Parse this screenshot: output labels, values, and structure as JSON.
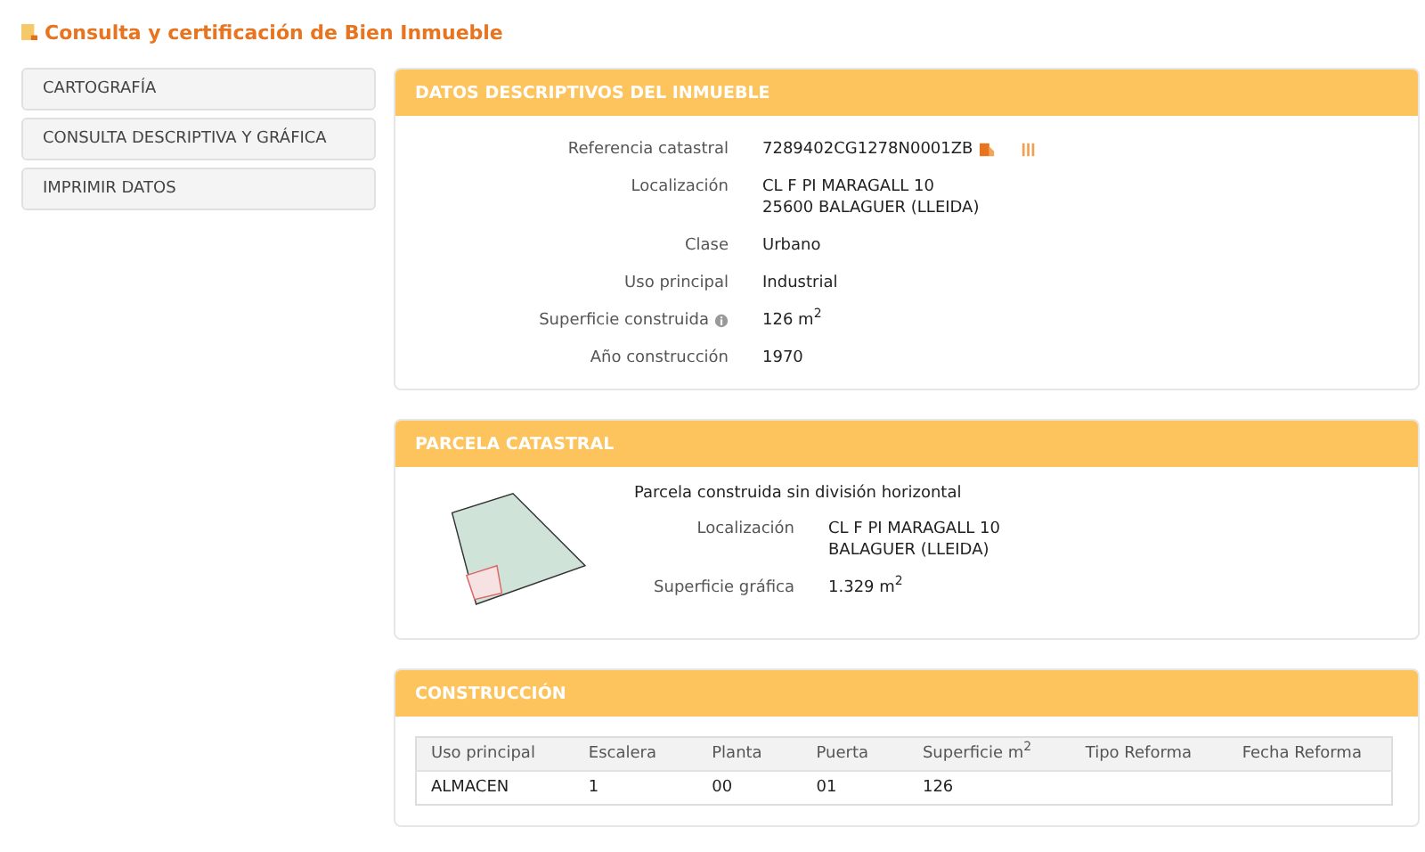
{
  "page_title": "Consulta y certificación de Bien Inmueble",
  "sidebar": {
    "items": [
      {
        "label": "CARTOGRAFÍA"
      },
      {
        "label": "CONSULTA DESCRIPTIVA Y GRÁFICA"
      },
      {
        "label": "IMPRIMIR DATOS"
      }
    ]
  },
  "datos": {
    "title": "DATOS DESCRIPTIVOS DEL INMUEBLE",
    "fields": [
      {
        "label": "Referencia catastral",
        "lines": [
          "7289402CG1278N0001ZB"
        ],
        "kind": "reference"
      },
      {
        "label": "Localización",
        "lines": [
          "CL F PI MARAGALL 10",
          "25600 BALAGUER (LLEIDA)"
        ],
        "kind": "plain"
      },
      {
        "label": "Clase",
        "lines": [
          "Urbano"
        ],
        "kind": "plain"
      },
      {
        "label": "Uso principal",
        "lines": [
          "Industrial"
        ],
        "kind": "plain"
      },
      {
        "label": "Superficie construida",
        "lines": [
          "126 m$^{2}$"
        ],
        "kind": "info"
      },
      {
        "label": "Año construcción",
        "lines": [
          "1970"
        ],
        "kind": "plain"
      }
    ]
  },
  "parcela": {
    "title": "PARCELA CATASTRAL",
    "subtitle": "Parcela construida sin división horizontal",
    "fields": [
      {
        "label": "Localización",
        "lines": [
          "CL F PI MARAGALL 10",
          "BALAGUER (LLEIDA)"
        ]
      },
      {
        "label": "Superficie gráfica",
        "lines": [
          "1.329 m$^{2}$"
        ]
      }
    ]
  },
  "construccion": {
    "title": "CONSTRUCCIÓN",
    "table": {
      "columns": [
        "Uso principal",
        "Escalera",
        "Planta",
        "Puerta",
        "Superficie m$^{2}$",
        "Tipo Reforma",
        "Fecha Reforma"
      ],
      "rows": [
        [
          "ALMACEN",
          "1",
          "00",
          "01",
          "126",
          "",
          ""
        ]
      ]
    }
  }
}
